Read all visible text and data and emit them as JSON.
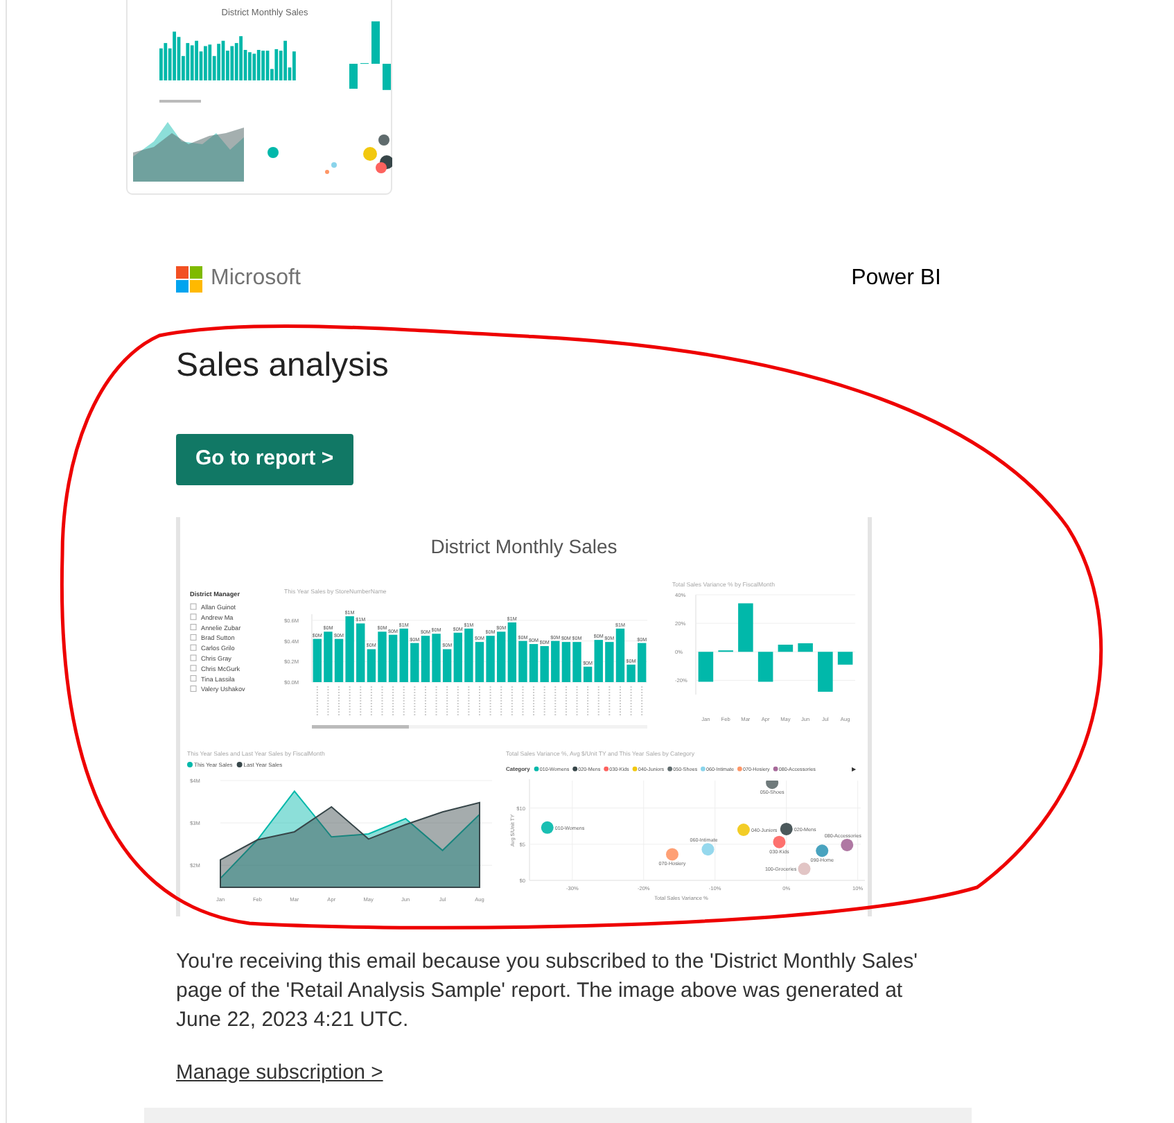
{
  "thumbnail": {
    "title": "District Monthly Sales"
  },
  "header": {
    "brand": "Microsoft",
    "product": "Power BI"
  },
  "title": "Sales analysis",
  "button": "Go to report >",
  "report": {
    "title": "District Monthly Sales",
    "slicer": {
      "title": "District Manager",
      "items": [
        {
          "label": "Allan Guinot",
          "checked": false
        },
        {
          "label": "Andrew Ma",
          "checked": false
        },
        {
          "label": "Annelie Zubar",
          "checked": false
        },
        {
          "label": "Brad Sutton",
          "checked": false
        },
        {
          "label": "Carlos Grilo",
          "checked": false
        },
        {
          "label": "Chris Gray",
          "checked": false
        },
        {
          "label": "Chris McGurk",
          "checked": false
        },
        {
          "label": "Tina Lassila",
          "checked": false
        },
        {
          "label": "Valery Ushakov",
          "checked": false
        }
      ]
    },
    "bar_chart": {
      "chart_data": {
        "type": "bar",
        "title": "This Year Sales by StoreNumberName",
        "grid": true,
        "values": [
          0.42,
          0.49,
          0.42,
          0.64,
          0.57,
          0.32,
          0.49,
          0.46,
          0.52,
          0.38,
          0.45,
          0.47,
          0.32,
          0.48,
          0.52,
          0.39,
          0.45,
          0.49,
          0.58,
          0.4,
          0.37,
          0.35,
          0.4,
          0.39,
          0.39,
          0.15,
          0.41,
          0.39,
          0.52,
          0.17,
          0.38
        ],
        "value_labels": [
          "$0M",
          "$0M",
          "$0M",
          "$1M",
          "$1M",
          "$0M",
          "$0M",
          "$0M",
          "$1M",
          "$0M",
          "$0M",
          "$0M",
          "$0M",
          "$0M",
          "$1M",
          "$0M",
          "$0M",
          "$0M",
          "$1M",
          "$0M",
          "$0M",
          "$0M",
          "$0M",
          "$0M",
          "$0M",
          "$0M",
          "$0M",
          "$0M",
          "$1M",
          "$0M",
          "$0M"
        ],
        "ylim": [
          0,
          0.66
        ],
        "yticks": [
          {
            "value": 0,
            "label": "$0.0M"
          },
          {
            "value": 0.2,
            "label": "$0.2M"
          },
          {
            "value": 0.4,
            "label": "$0.4M"
          },
          {
            "value": 0.6,
            "label": "$0.6M"
          }
        ]
      }
    },
    "variance_chart": {
      "chart_data": {
        "type": "bar",
        "title": "Total Sales Variance % by FiscalMonth",
        "grid": true,
        "categories": [
          "Jan",
          "Feb",
          "Mar",
          "Apr",
          "May",
          "Jun",
          "Jul",
          "Aug"
        ],
        "values": [
          -21,
          1,
          34,
          -21,
          5,
          6,
          -28,
          -9
        ],
        "ylim": [
          -30,
          40
        ],
        "yticks": [
          {
            "value": -20,
            "label": "-20%"
          },
          {
            "value": 0,
            "label": "0%"
          },
          {
            "value": 20,
            "label": "20%"
          },
          {
            "value": 40,
            "label": "40%"
          }
        ]
      }
    },
    "area_chart": {
      "chart_data": {
        "type": "area",
        "title": "This Year Sales and Last Year Sales by FiscalMonth",
        "grid": true,
        "legend": "top",
        "categories": [
          "Jan",
          "Feb",
          "Mar",
          "Apr",
          "May",
          "Jun",
          "Jul",
          "Aug"
        ],
        "series": [
          {
            "name": "This Year Sales",
            "color": "#01b8aa",
            "values": [
              1.69,
              2.6,
              3.75,
              2.67,
              2.74,
              3.1,
              2.35,
              3.2
            ]
          },
          {
            "name": "Last Year Sales",
            "color": "#374649",
            "values": [
              2.13,
              2.6,
              2.79,
              3.38,
              2.62,
              2.96,
              3.26,
              3.48
            ]
          }
        ],
        "ylim": [
          1.48,
          4
        ],
        "yticks": [
          {
            "value": 2,
            "label": "$2M"
          },
          {
            "value": 3,
            "label": "$3M"
          },
          {
            "value": 4,
            "label": "$4M"
          }
        ]
      }
    },
    "scatter_chart": {
      "legend_title": "Category",
      "more": "▶",
      "chart_data": {
        "type": "scatter",
        "title": "Total Sales Variance %, Avg $/Unit TY and This Year Sales by Category",
        "grid": true,
        "xlabel": "Total Sales Variance %",
        "ylabel": "Avg $/Unit TY",
        "series": [
          {
            "name": "010-Womens",
            "color": "#01b8aa",
            "x": [
              -33.5
            ],
            "values": [
              7.3
            ]
          },
          {
            "name": "020-Mens",
            "color": "#374649",
            "x": [
              0
            ],
            "values": [
              7.1
            ]
          },
          {
            "name": "030-Kids",
            "color": "#fd625e",
            "x": [
              -1
            ],
            "values": [
              5.3
            ]
          },
          {
            "name": "040-Juniors",
            "color": "#f2c80f",
            "x": [
              -6
            ],
            "values": [
              7
            ]
          },
          {
            "name": "050-Shoes",
            "color": "#5f6b6d",
            "x": [
              -2
            ],
            "values": [
              13.5
            ]
          },
          {
            "name": "060-Intimate",
            "color": "#8ad4eb",
            "x": [
              -11
            ],
            "values": [
              4.3
            ]
          },
          {
            "name": "070-Hosiery",
            "color": "#fe9666",
            "x": [
              -16
            ],
            "values": [
              3.6
            ]
          },
          {
            "name": "080-Accessories",
            "color": "#a66999",
            "x": [
              8.5
            ],
            "values": [
              4.9
            ]
          },
          {
            "color": "#3599b8",
            "x": [
              5
            ],
            "values": [
              4.1
            ]
          },
          {
            "color": "#dfbfbf",
            "x": [
              2.5
            ],
            "values": [
              1.6
            ]
          }
        ],
        "annotations": [
          {
            "text": "010-Womens",
            "x": -33.5,
            "y": 7.3
          },
          {
            "text": "020-Mens",
            "x": 0,
            "y": 7.1
          },
          {
            "text": "030-Kids",
            "x": -1,
            "y": 5.3
          },
          {
            "text": "040-Juniors",
            "x": -6,
            "y": 7
          },
          {
            "text": "050-Shoes",
            "x": -2,
            "y": 13.5
          },
          {
            "text": "060-Intimate",
            "x": -11,
            "y": 4.3
          },
          {
            "text": "070-Hosiery",
            "x": -16,
            "y": 3.6
          },
          {
            "text": "080-Accessories",
            "x": 8.5,
            "y": 4.9
          },
          {
            "text": "090-Home",
            "x": 5,
            "y": 4.1
          },
          {
            "text": "100-Groceries",
            "x": 2.5,
            "y": 1.6
          }
        ],
        "legend": "top",
        "xlim": [
          -36,
          11
        ],
        "ylim": [
          0,
          14
        ],
        "xticks": [
          {
            "value": -30,
            "label": "-30%"
          },
          {
            "value": -20,
            "label": "-20%"
          },
          {
            "value": -10,
            "label": "-10%"
          },
          {
            "value": 0,
            "label": "0%"
          },
          {
            "value": 10,
            "label": "10%"
          }
        ],
        "yticks": [
          {
            "value": 0,
            "label": "$0"
          },
          {
            "value": 5,
            "label": "$5"
          },
          {
            "value": 10,
            "label": "$10"
          }
        ]
      }
    }
  },
  "notice": "You're receiving this email because you subscribed to the 'District Monthly Sales' page of the 'Retail Analysis Sample' report. The image above was generated at June 22, 2023 4:21 UTC.",
  "manage_link": "Manage subscription >"
}
